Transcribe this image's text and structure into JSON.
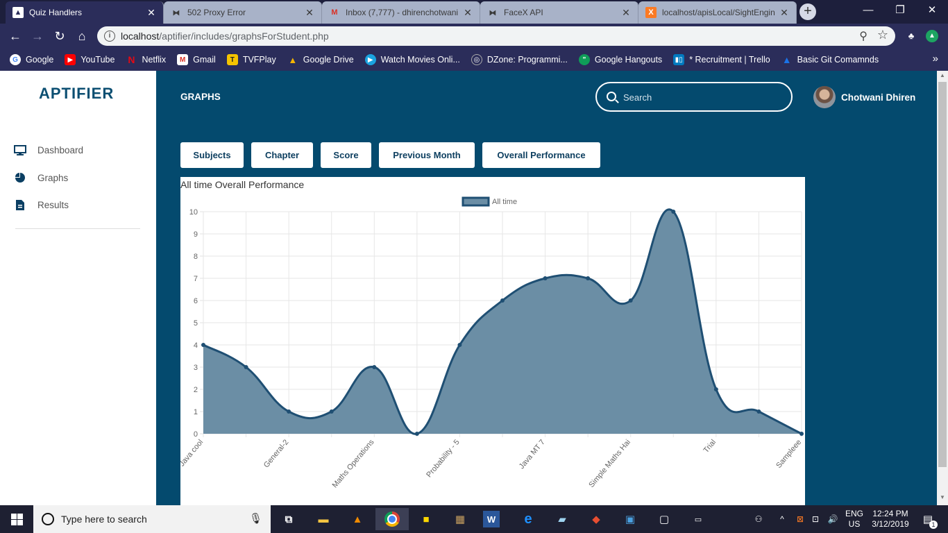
{
  "browser": {
    "tabs": [
      {
        "label": "Quiz Handlers",
        "icon": "aptifier-favicon-icon",
        "close": "✕"
      },
      {
        "label": "502 Proxy Error",
        "icon": "bowtie-favicon-icon",
        "close": "✕"
      },
      {
        "label": "Inbox (7,777) - dhirenchotwani",
        "icon": "gmail-favicon-icon",
        "close": "✕"
      },
      {
        "label": "FaceX API",
        "icon": "bowtie-favicon-icon",
        "close": "✕"
      },
      {
        "label": "localhost/apisLocal/SightEngin",
        "icon": "xampp-favicon-icon",
        "close": "✕"
      }
    ],
    "new_tab": "+",
    "window_controls": {
      "minimize": "—",
      "maximize": "❐",
      "close": "✕"
    },
    "url_host": "localhost",
    "url_path": "/aptifier/includes/graphsForStudent.php",
    "bookmarks": [
      {
        "label": "Google",
        "icon": "google-icon",
        "color": "#ffffff"
      },
      {
        "label": "YouTube",
        "icon": "youtube-icon",
        "color": "#ff0000"
      },
      {
        "label": "Netflix",
        "icon": "netflix-icon",
        "color": "#e50914"
      },
      {
        "label": "Gmail",
        "icon": "gmail-icon",
        "color": "#d93025"
      },
      {
        "label": "TVFPlay",
        "icon": "tvfplay-icon",
        "color": "#f5c400"
      },
      {
        "label": "Google Drive",
        "icon": "google-drive-icon",
        "color": "#1fa463"
      },
      {
        "label": "Watch Movies Onli...",
        "icon": "play-icon",
        "color": "#1aa3e0"
      },
      {
        "label": "DZone: Programmi...",
        "icon": "dzone-icon",
        "color": "#555a75"
      },
      {
        "label": "Google Hangouts",
        "icon": "hangouts-icon",
        "color": "#0f9d58"
      },
      {
        "label": "* Recruitment | Trello",
        "icon": "trello-icon",
        "color": "#0079bf"
      },
      {
        "label": "Basic Git Comamnds",
        "icon": "git-icon",
        "color": "#1a73e8"
      }
    ],
    "bookmarks_more": "»"
  },
  "app": {
    "logo": "APTIFIER",
    "sidebar": [
      {
        "label": "Dashboard",
        "icon": "monitor-icon"
      },
      {
        "label": "Graphs",
        "icon": "pie-chart-icon"
      },
      {
        "label": "Results",
        "icon": "document-icon"
      }
    ],
    "header": {
      "title": "GRAPHS",
      "search_placeholder": "Search",
      "user_name": "Chotwani Dhiren"
    },
    "filters": [
      "Subjects",
      "Chapter",
      "Score",
      "Previous Month",
      "Overall Performance"
    ],
    "chart_heading": "All time Overall Performance"
  },
  "chart_data": {
    "type": "area",
    "title": "All time Overall Performance",
    "categories": [
      "Java cool",
      "",
      "General-2",
      "",
      "Maths Operations",
      "",
      "Probability - 5",
      "",
      "Java MT 7",
      "",
      "Simple Maths Hai",
      "",
      "Trial",
      "",
      "Sampleee"
    ],
    "series": [
      {
        "name": "All time",
        "values": [
          4,
          3,
          1,
          1,
          3,
          0,
          4,
          6,
          7,
          7,
          6,
          10,
          2,
          1,
          0
        ]
      }
    ],
    "ylim": [
      0,
      10
    ],
    "yticks": [
      0,
      1,
      2,
      3,
      4,
      5,
      6,
      7,
      8,
      9,
      10
    ],
    "legend": "top-center",
    "grid": true,
    "colors": {
      "line": "#1f4f73",
      "fill": "#6b8ea5"
    }
  },
  "taskbar": {
    "search_placeholder": "Type here to search",
    "apps": [
      "task-view-icon",
      "file-explorer-icon",
      "vlc-icon",
      "chrome-icon",
      "sticky-notes-icon",
      "dosbox-icon",
      "word-icon",
      "edge-icon",
      "notepad-icon",
      "git-icon",
      "control-panel-icon",
      "terminal-icon",
      "cmd-icon"
    ],
    "language": "ENG",
    "region": "US",
    "time": "12:24 PM",
    "date": "3/12/2019",
    "notifications": "1"
  }
}
